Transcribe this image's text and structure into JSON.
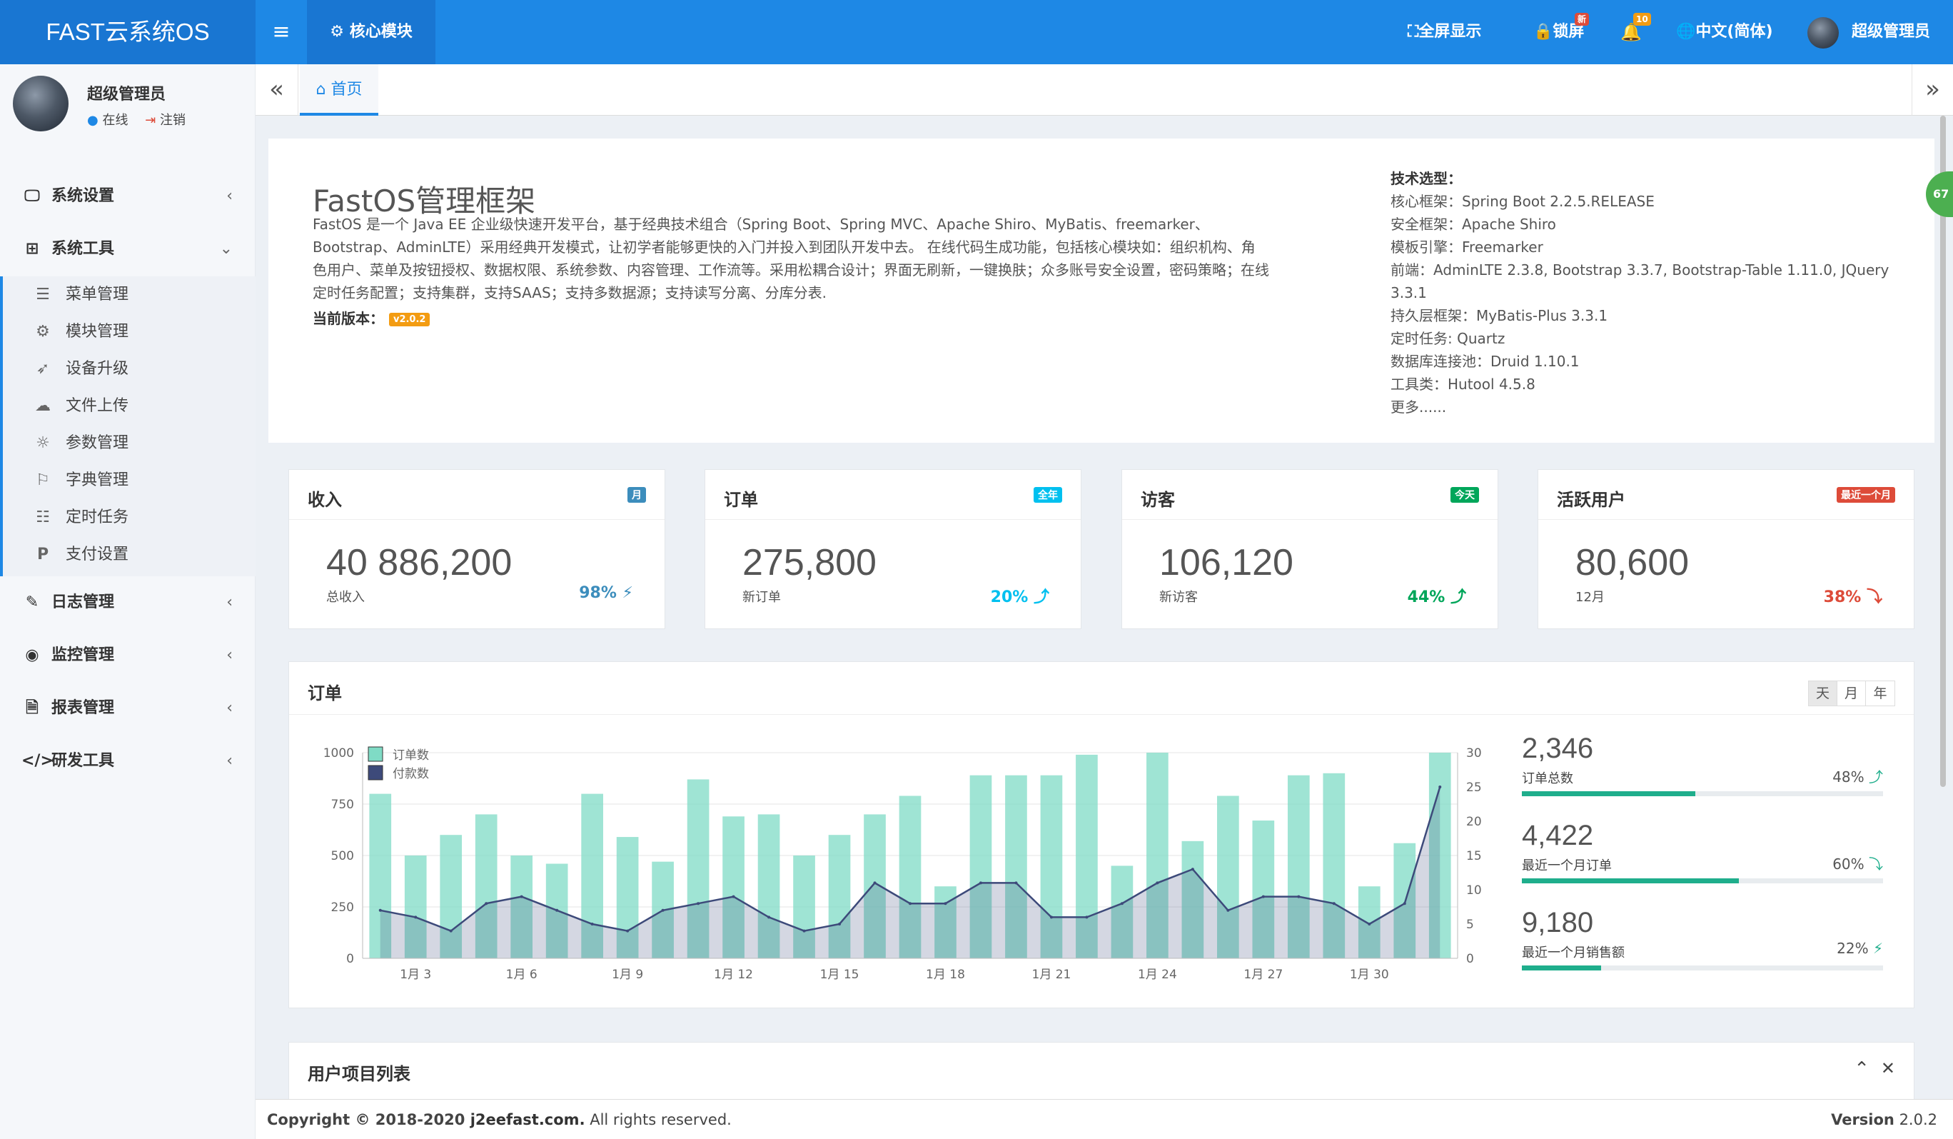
{
  "topbar": {
    "logo": "FAST云系统OS",
    "module_tab": "核心模块",
    "fullscreen": "全屏显示",
    "lock": "锁屏",
    "lock_badge": "新",
    "notify_badge": "10",
    "language": "中文(简体)",
    "user": "超级管理员"
  },
  "sidebar": {
    "user_name": "超级管理员",
    "status_online": "在线",
    "logout": "注销",
    "menu": [
      {
        "label": "系统设置",
        "icon": "monitor-icon"
      },
      {
        "label": "系统工具",
        "icon": "windows-icon"
      },
      {
        "label": "日志管理",
        "icon": "edit-icon"
      },
      {
        "label": "监控管理",
        "icon": "eye-icon"
      },
      {
        "label": "报表管理",
        "icon": "excel-file-icon"
      },
      {
        "label": "研发工具",
        "icon": "code-icon"
      }
    ],
    "submenu": [
      {
        "label": "菜单管理",
        "icon": "list-icon"
      },
      {
        "label": "模块管理",
        "icon": "gears-icon"
      },
      {
        "label": "设备升级",
        "icon": "rocket-icon"
      },
      {
        "label": "文件上传",
        "icon": "cloud-upload-icon"
      },
      {
        "label": "参数管理",
        "icon": "sun-icon"
      },
      {
        "label": "字典管理",
        "icon": "bookmark-icon"
      },
      {
        "label": "定时任务",
        "icon": "tasks-icon"
      },
      {
        "label": "支付设置",
        "icon": "paypal-icon"
      }
    ]
  },
  "tabs": {
    "home": "首页"
  },
  "intro": {
    "title": "FastOS管理框架",
    "desc": "FastOS 是一个 Java EE 企业级快速开发平台，基于经典技术组合（Spring Boot、Spring MVC、Apache Shiro、MyBatis、freemarker、Bootstrap、AdminLTE）采用经典开发模式，让初学者能够更快的入门并投入到团队开发中去。 在线代码生成功能，包括核心模块如：组织机构、角色用户、菜单及按钮授权、数据权限、系统参数、内容管理、工作流等。采用松耦合设计；界面无刷新，一键换肤；众多账号安全设置，密码策略；在线定时任务配置；支持集群，支持SAAS；支持多数据源；支持读写分离、分库分表.",
    "version_label": "当前版本：",
    "version": "v2.0.2",
    "tech_title": "技术选型：",
    "tech": [
      "核心框架：Spring Boot 2.2.5.RELEASE",
      "安全框架：Apache Shiro",
      "模板引擎：Freemarker",
      "前端：AdminLTE 2.3.8, Bootstrap 3.3.7, Bootstrap-Table 1.11.0, JQuery 3.3.1",
      "持久层框架：MyBatis-Plus 3.3.1",
      "定时任务: Quartz",
      "数据库连接池：Druid 1.10.1",
      "工具类：Hutool 4.5.8",
      "更多......"
    ],
    "side_badge": "67"
  },
  "stats": [
    {
      "title": "收入",
      "badge": "月",
      "badge_color": "#3c8dbc",
      "value": "40 886,200",
      "sub": "总收入",
      "pct": "98%",
      "pct_color": "#3c8dbc",
      "trend": "⚡"
    },
    {
      "title": "订单",
      "badge": "全年",
      "badge_color": "#00c0ef",
      "value": "275,800",
      "sub": "新订单",
      "pct": "20%",
      "pct_color": "#00c0ef",
      "trend": "⤴"
    },
    {
      "title": "访客",
      "badge": "今天",
      "badge_color": "#00a65a",
      "value": "106,120",
      "sub": "新访客",
      "pct": "44%",
      "pct_color": "#00a65a",
      "trend": "⤴"
    },
    {
      "title": "活跃用户",
      "badge": "最近一个月",
      "badge_color": "#dd4b39",
      "value": "80,600",
      "sub": "12月",
      "pct": "38%",
      "pct_color": "#dd4b39",
      "trend": "⤵"
    }
  ],
  "orders": {
    "title": "订单",
    "range_buttons": [
      "天",
      "月",
      "年"
    ],
    "summary": [
      {
        "value": "2,346",
        "label": "订单总数",
        "pct": "48%",
        "fill": 0.48,
        "trend": "⤴"
      },
      {
        "value": "4,422",
        "label": "最近一个月订单",
        "pct": "60%",
        "fill": 0.6,
        "trend": "⤵"
      },
      {
        "value": "9,180",
        "label": "最近一个月销售额",
        "pct": "22%",
        "fill": 0.22,
        "trend": "⚡"
      }
    ]
  },
  "chart_data": {
    "type": "bar",
    "x": [
      "1月 2",
      "1月 3",
      "1月 4",
      "1月 5",
      "1月 6",
      "1月 7",
      "1月 8",
      "1月 9",
      "1月 10",
      "1月 11",
      "1月 12",
      "1月 13",
      "1月 14",
      "1月 15",
      "1月 16",
      "1月 17",
      "1月 18",
      "1月 19",
      "1月 20",
      "1月 21",
      "1月 22",
      "1月 23",
      "1月 24",
      "1月 25",
      "1月 26",
      "1月 27",
      "1月 28",
      "1月 29",
      "1月 30",
      "1月 31"
    ],
    "xtick_labels": [
      "1月 3",
      "1月 6",
      "1月 9",
      "1月 12",
      "1月 15",
      "1月 18",
      "1月 21",
      "1月 24",
      "1月 27",
      "1月 30"
    ],
    "series": [
      {
        "name": "订单数",
        "type": "bar",
        "axis": "left",
        "color": "#7fdbc5",
        "values": [
          800,
          500,
          600,
          700,
          500,
          460,
          800,
          590,
          470,
          870,
          690,
          700,
          500,
          600,
          700,
          790,
          350,
          890,
          890,
          890,
          990,
          450,
          1000,
          570,
          790,
          670,
          890,
          900,
          350,
          560,
          1000
        ]
      },
      {
        "name": "付款数",
        "type": "area",
        "axis": "right",
        "color": "#3d4a7a",
        "values": [
          7,
          6,
          4,
          8,
          9,
          7,
          5,
          4,
          7,
          8,
          9,
          6,
          4,
          5,
          11,
          8,
          8,
          11,
          11,
          6,
          6,
          8,
          11,
          13,
          7,
          9,
          9,
          8,
          5,
          8,
          25
        ]
      }
    ],
    "y_left": {
      "min": 0,
      "max": 1000,
      "ticks": [
        0,
        250,
        500,
        750,
        1000
      ]
    },
    "y_right": {
      "min": 0,
      "max": 30,
      "ticks": [
        0,
        5,
        10,
        15,
        20,
        25,
        30
      ]
    },
    "legend": "top-left"
  },
  "projects": {
    "title": "用户项目列表"
  },
  "footer": {
    "copyright_prefix": "Copyright © 2018-2020 ",
    "site": "j2eefast.com.",
    "rights": " All rights reserved.",
    "version_label": "Version",
    "version": "2.0.2"
  }
}
